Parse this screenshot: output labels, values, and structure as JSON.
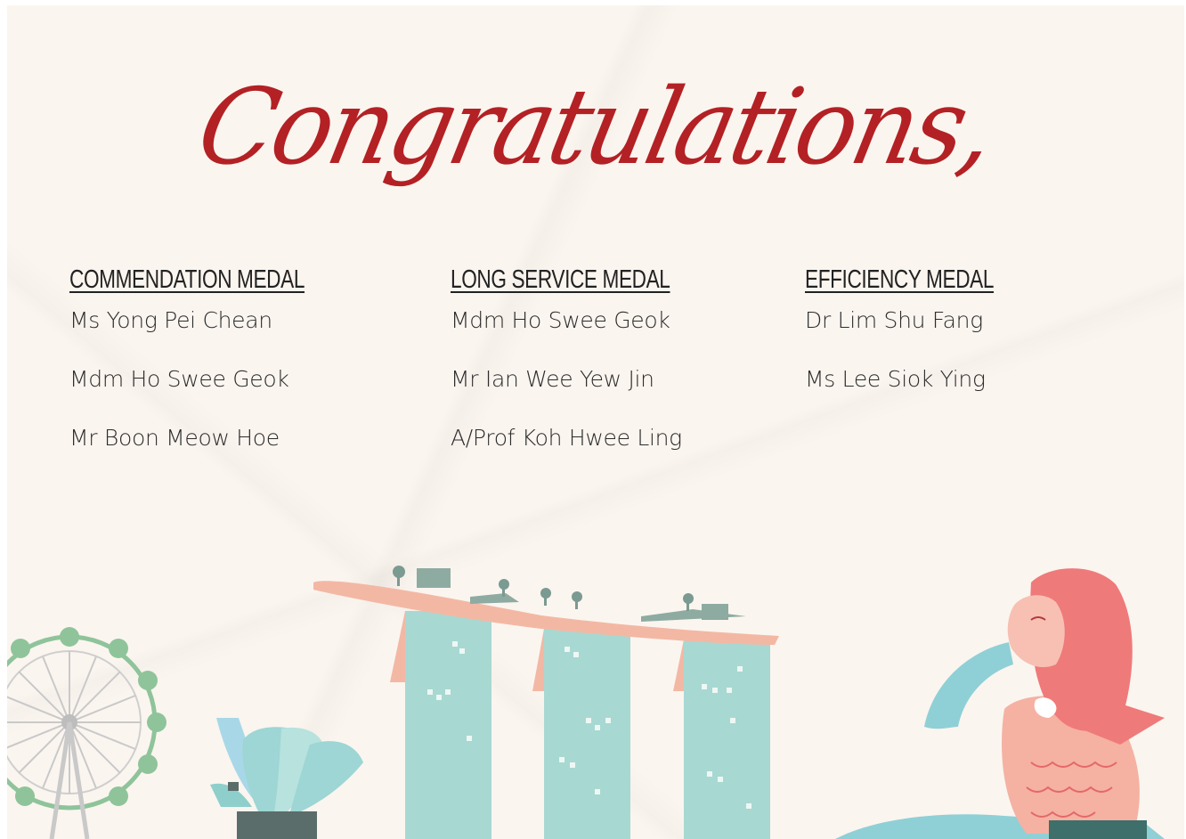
{
  "title": "Congratulations,",
  "columns": [
    {
      "heading": "COMMENDATION MEDAL",
      "names": [
        "Ms Yong Pei Chean",
        "Mdm Ho Swee Geok",
        "Mr Boon Meow Hoe"
      ]
    },
    {
      "heading": "LONG SERVICE MEDAL",
      "names": [
        "Mdm Ho Swee Geok",
        "Mr Ian Wee Yew Jin",
        "A/Prof Koh Hwee Ling"
      ]
    },
    {
      "heading": "EFFICIENCY MEDAL",
      "names": [
        "Dr Lim Shu Fang",
        "Ms Lee Siok Ying"
      ]
    }
  ],
  "illustrations": [
    "ferris-wheel",
    "lotus-museum",
    "hotel-towers",
    "merlion"
  ],
  "colors": {
    "background": "#fbf5ef",
    "title": "#b32125",
    "text": "#2c2c2c",
    "tower": "#a8d8d2",
    "roof": "#f3b8a4",
    "merlion": "#ef7a7a",
    "water": "#8fd0d6",
    "wheel": "#8fc49a"
  }
}
